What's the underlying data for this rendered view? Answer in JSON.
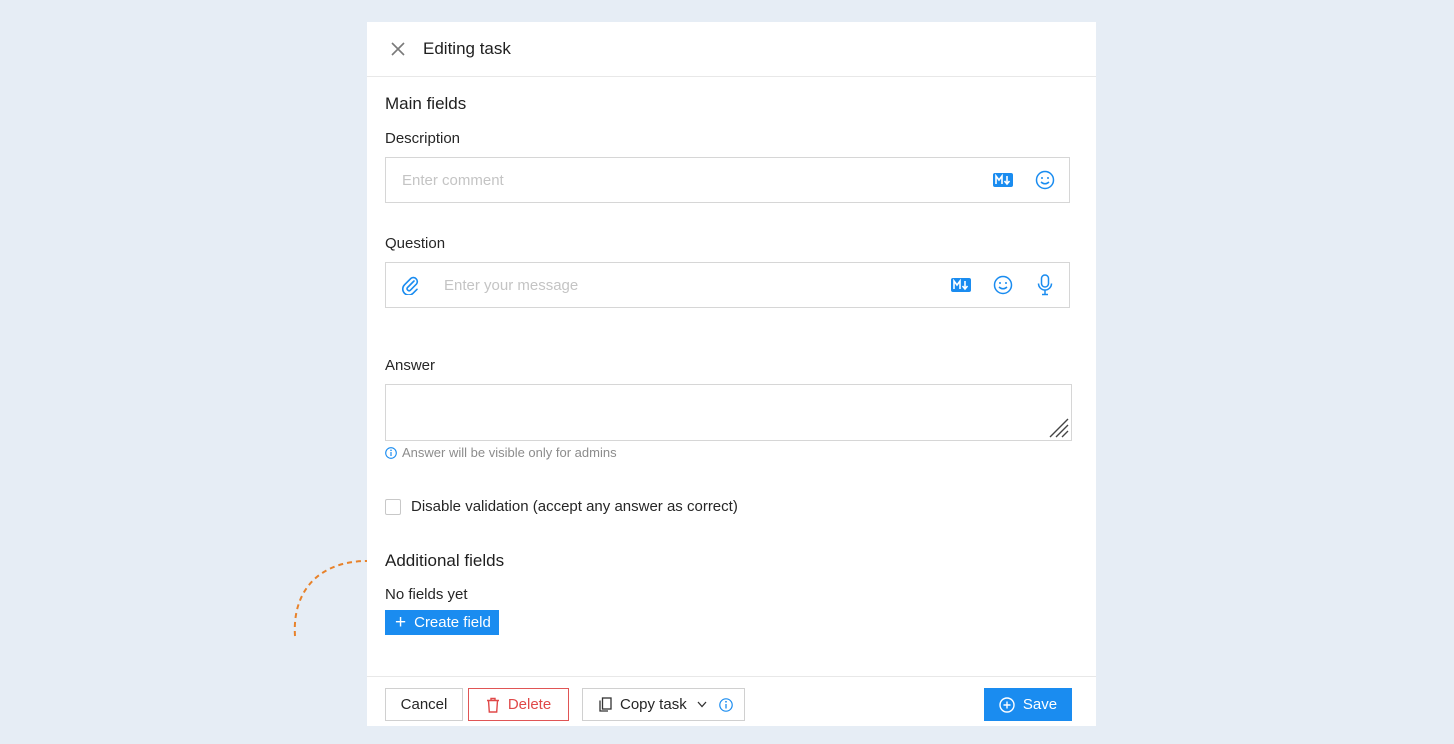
{
  "header": {
    "title": "Editing task"
  },
  "main": {
    "section_title": "Main fields",
    "description": {
      "label": "Description",
      "placeholder": "Enter comment"
    },
    "question": {
      "label": "Question",
      "placeholder": "Enter your message"
    },
    "answer": {
      "label": "Answer",
      "value": "",
      "hint": "Answer will be visible only for admins"
    },
    "disable_validation": {
      "label": "Disable validation (accept any answer as correct)",
      "checked": false
    }
  },
  "additional": {
    "section_title": "Additional fields",
    "empty_text": "No fields yet",
    "create_label": "Create field"
  },
  "footer": {
    "cancel_label": "Cancel",
    "delete_label": "Delete",
    "copy_label": "Copy task",
    "save_label": "Save"
  },
  "colors": {
    "accent": "#1a8cf0",
    "danger": "#e04848",
    "annotation": "#e8822a",
    "background": "#e6edf5"
  },
  "icons": [
    "close-icon",
    "markdown-icon",
    "emoji-icon",
    "paperclip-icon",
    "microphone-icon",
    "info-icon",
    "trash-icon",
    "copy-icon",
    "chevron-down-icon",
    "plus-circle-icon"
  ]
}
